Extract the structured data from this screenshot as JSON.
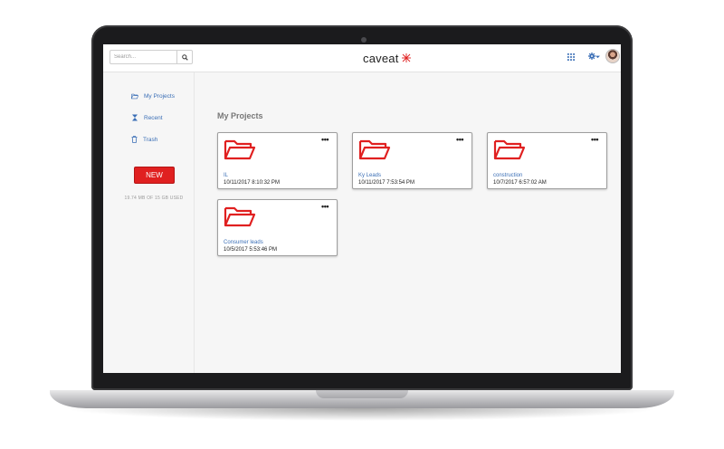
{
  "header": {
    "search_placeholder": "Search...",
    "logo": "caveat"
  },
  "sidebar": {
    "items": [
      {
        "label": "My Projects",
        "icon": "folder-open-icon"
      },
      {
        "label": "Recent",
        "icon": "hourglass-icon"
      },
      {
        "label": "Trash",
        "icon": "trash-icon"
      }
    ],
    "new_label": "NEW",
    "usage": "19.74 MB OF 15 GB USED"
  },
  "main": {
    "title": "My Projects",
    "cards": [
      {
        "name": "IL",
        "date": "10/11/2017 8:10:32 PM",
        "more": "•••"
      },
      {
        "name": "Ky Leads",
        "date": "10/11/2017 7:53:54 PM",
        "more": "•••"
      },
      {
        "name": "construction",
        "date": "10/7/2017 6:57:02 AM",
        "more": "•••"
      },
      {
        "name": "Consumer leads",
        "date": "10/5/2017 5:53:46 PM",
        "more": "•••"
      }
    ]
  },
  "colors": {
    "accent": "#e02020",
    "link": "#3b6fb6",
    "screen_bg": "#f6f6f6"
  }
}
